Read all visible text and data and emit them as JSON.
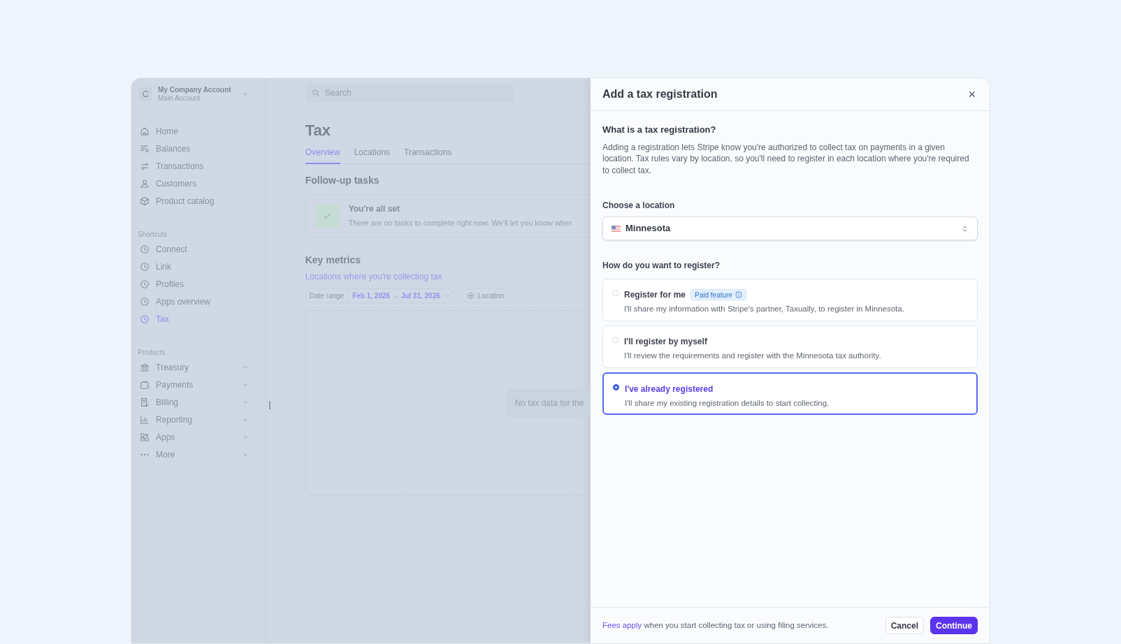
{
  "account": {
    "initial": "C",
    "name": "My Company Account",
    "subtitle": "Main Account"
  },
  "sidebar": {
    "sections": [
      {
        "items": [
          {
            "label": "Home",
            "selected": false
          },
          {
            "label": "Balances",
            "selected": false
          },
          {
            "label": "Transactions",
            "selected": false
          },
          {
            "label": "Customers",
            "selected": false
          },
          {
            "label": "Product catalog",
            "selected": false
          }
        ]
      },
      {
        "heading": "Shortcuts",
        "items": [
          {
            "label": "Connect",
            "selected": false
          },
          {
            "label": "Link",
            "selected": false
          },
          {
            "label": "Profiles",
            "selected": false
          },
          {
            "label": "Apps overview",
            "selected": false
          },
          {
            "label": "Tax",
            "selected": true
          }
        ]
      },
      {
        "heading": "Products",
        "items": [
          {
            "label": "Treasury",
            "selected": false,
            "expandable": true
          },
          {
            "label": "Payments",
            "selected": false,
            "expandable": true
          },
          {
            "label": "Billing",
            "selected": false,
            "expandable": true
          },
          {
            "label": "Reporting",
            "selected": false,
            "expandable": true
          },
          {
            "label": "Apps",
            "selected": false,
            "expandable": true
          },
          {
            "label": "More",
            "selected": false,
            "expandable": true
          }
        ]
      }
    ]
  },
  "search": {
    "placeholder": "Search"
  },
  "page": {
    "title": "Tax",
    "tabs": [
      {
        "label": "Overview",
        "selected": true
      },
      {
        "label": "Locations",
        "selected": false
      },
      {
        "label": "Transactions",
        "selected": false
      }
    ],
    "follow_up": {
      "heading": "Follow-up tasks",
      "title": "You're all set",
      "text": "There are no tasks to complete right now. We'll let you know wher"
    },
    "key_metrics": {
      "heading": "Key metrics",
      "link": "Locations where you're collecting tax",
      "date_label": "Date range",
      "date_value": "Feb 1, 2026 → Jul 31, 2026",
      "location_filter": "Location",
      "empty_text": "No tax data for the"
    }
  },
  "dialog": {
    "title": "Add a tax registration",
    "close": "×",
    "intro_heading": "What is a tax registration?",
    "intro_text": "Adding a registration lets Stripe know you're authorized to collect tax on payments in a given location. Tax rules vary by location, so you'll need to register in each location where you're required to collect tax.",
    "location_label": "Choose a location",
    "location_value": "Minnesota",
    "register_label": "How do you want to register?",
    "options": [
      {
        "title": "Register for me",
        "badge": "Paid feature",
        "description": "I'll share my information with Stripe's partner, Taxually, to register in Minnesota.",
        "selected": false
      },
      {
        "title": "I'll register by myself",
        "description": "I'll review the requirements and register with the Minnesota tax authority.",
        "selected": false
      },
      {
        "title": "I've already registered",
        "description": "I'll share my existing registration details to start collecting.",
        "selected": true
      }
    ],
    "footer": {
      "link": "Fees apply",
      "text": "when you start collecting tax or using filing services."
    },
    "buttons": [
      {
        "label": "Cancel",
        "kind": "secondary"
      },
      {
        "label": "Continue",
        "kind": "primary"
      }
    ]
  }
}
